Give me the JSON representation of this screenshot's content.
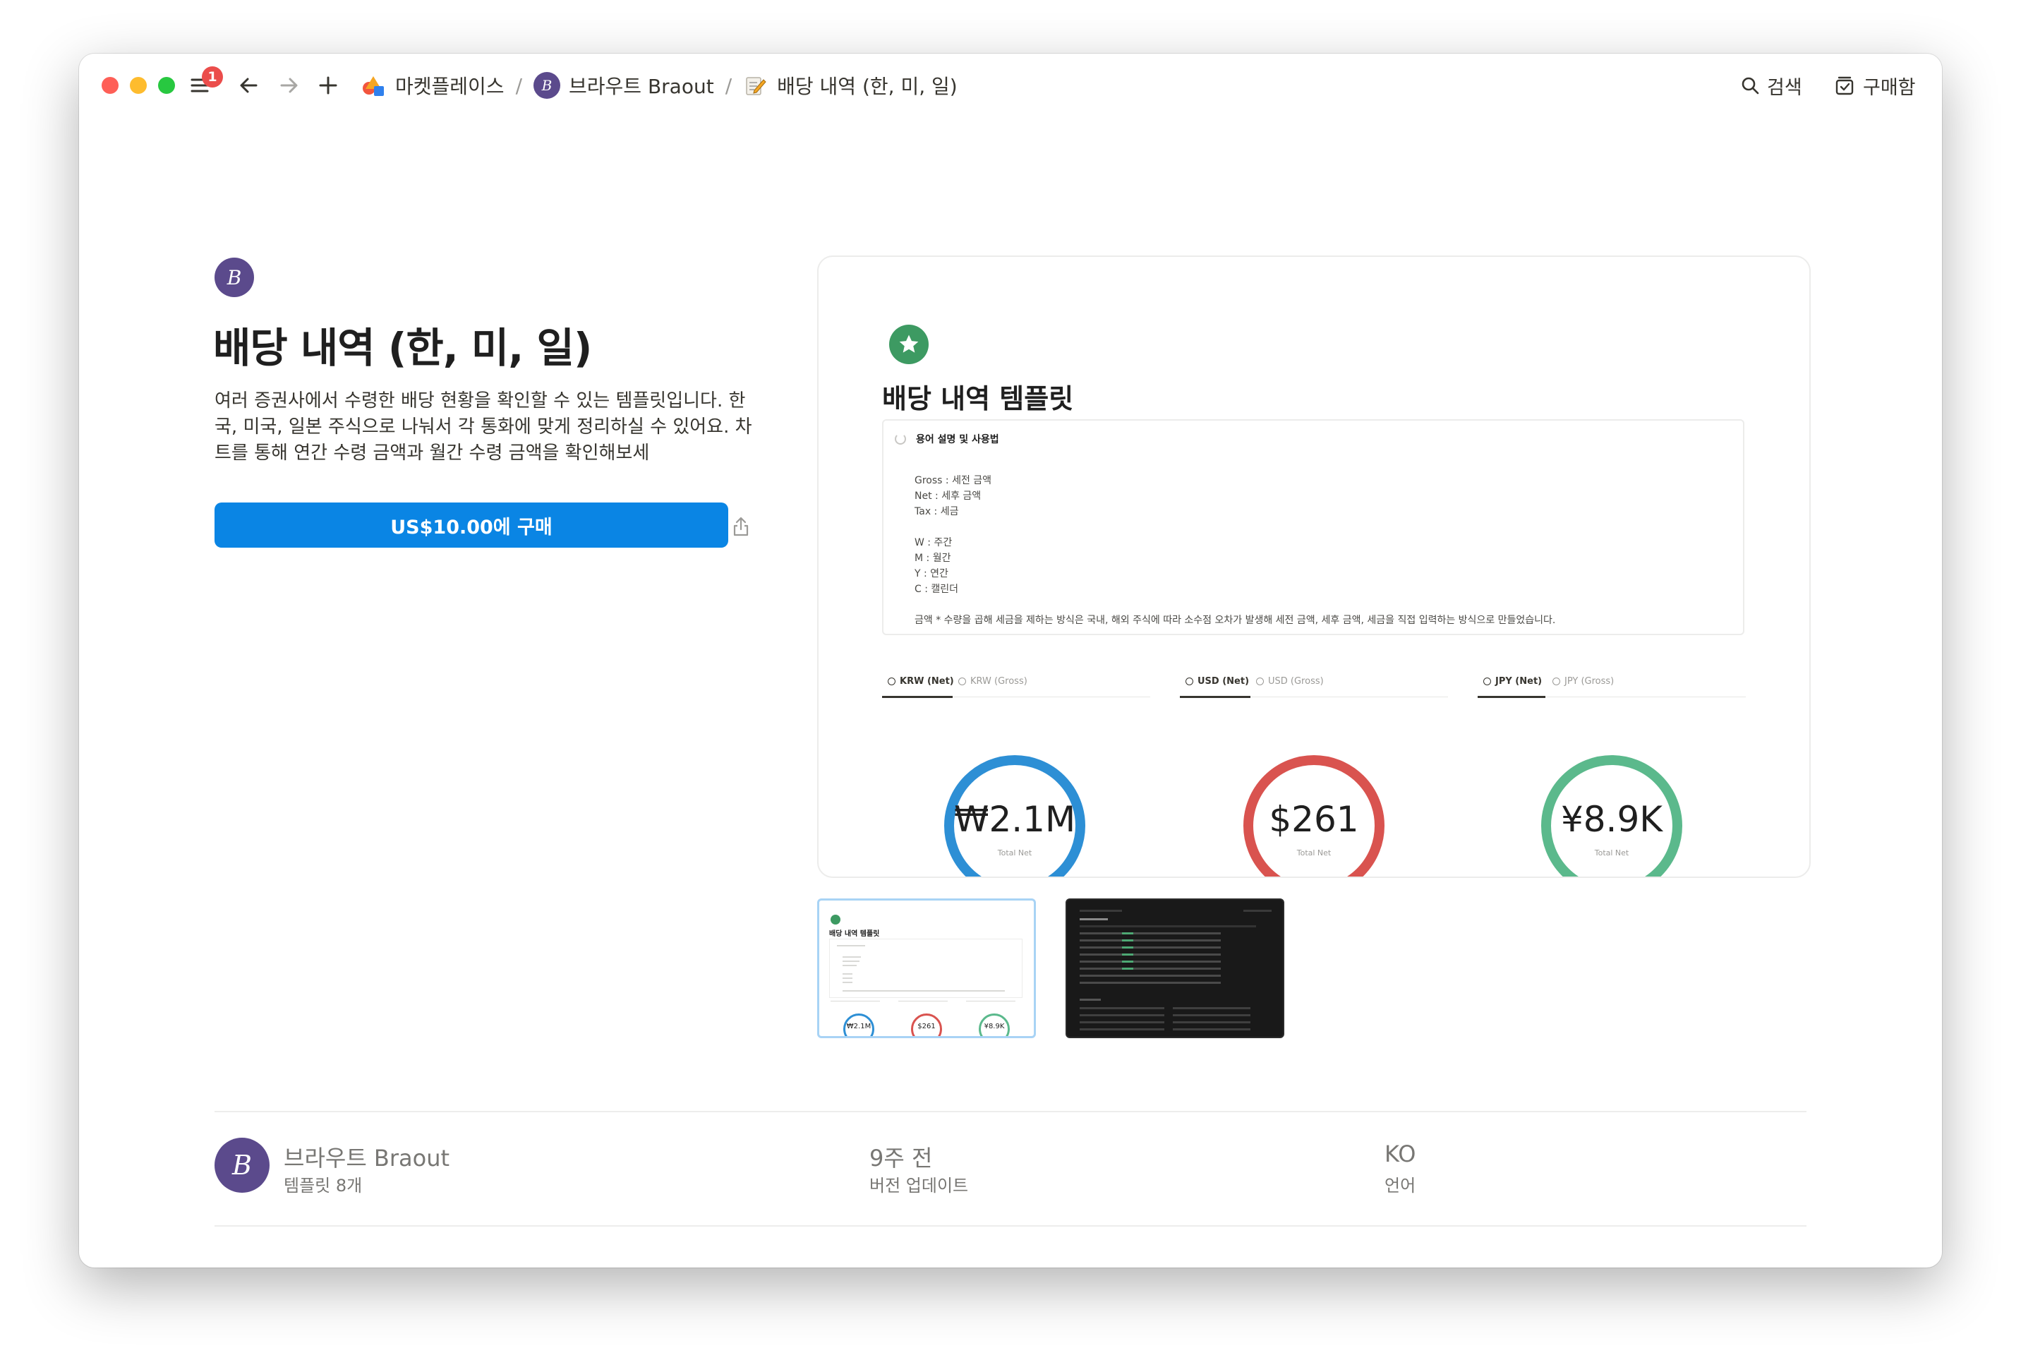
{
  "titlebar": {
    "notification_count": "1",
    "breadcrumbs": [
      {
        "label": "마켓플레이스"
      },
      {
        "label": "브라우트 Braout",
        "avatar": "B"
      },
      {
        "label": "배당 내역 (한, 미, 일)"
      }
    ],
    "search_label": "검색",
    "inbox_label": "구매함"
  },
  "product": {
    "creator_initial": "B",
    "title": "배당 내역 (한, 미, 일)",
    "description": "여러 증권사에서 수령한 배당 현황을 확인할 수 있는 템플릿입니다. 한국, 미국, 일본 주식으로 나눠서 각 통화에 맞게 정리하실 수 있어요. 차트를 통해 연간 수령 금액과 월간 수령 금액을 확인해보세",
    "buy_label": "US$10.00에 구매"
  },
  "preview": {
    "title": "배당 내역 템플릿",
    "callout": {
      "header": "용어 설명 및 사용법",
      "lines": [
        "Gross : 세전 금액",
        "Net : 세후 금액",
        "Tax : 세금",
        "W : 주간",
        "M : 월간",
        "Y : 연간",
        "C : 캘린더",
        "금액 * 수량을 곱해 세금을 제하는 방식은 국내, 해외 주식에 따라 소수점 오차가 발생해 세전 금액, 세후 금액, 세금을 직접 입력하는 방식으로 만들었습니다."
      ]
    },
    "tab_groups": [
      {
        "active": "KRW (Net)",
        "inactive": "KRW (Gross)"
      },
      {
        "active": "USD (Net)",
        "inactive": "USD (Gross)"
      },
      {
        "active": "JPY (Net)",
        "inactive": "JPY (Gross)"
      }
    ],
    "rings": [
      {
        "value": "₩2.1M",
        "label": "Total Net",
        "color": "#2d8fd5"
      },
      {
        "value": "$261",
        "label": "Total Net",
        "color": "#d9534f"
      },
      {
        "value": "¥8.9K",
        "label": "Total Net",
        "color": "#5bb98c"
      }
    ]
  },
  "thumbnails": {
    "first": {
      "title": "배당 내역 템플릿",
      "rings": [
        "₩2.1M",
        "$261",
        "¥8.9K"
      ]
    }
  },
  "footer": {
    "creator_initial": "B",
    "creator_name": "브라우트 Braout",
    "creator_templates": "템플릿 8개",
    "updated": "9주 전",
    "updated_label": "버전 업데이트",
    "language": "KO",
    "language_label": "언어"
  },
  "colors": {
    "accent": "#0a85e4",
    "creator_avatar": "#5b4a8c",
    "preview_icon": "#3d9a62"
  }
}
